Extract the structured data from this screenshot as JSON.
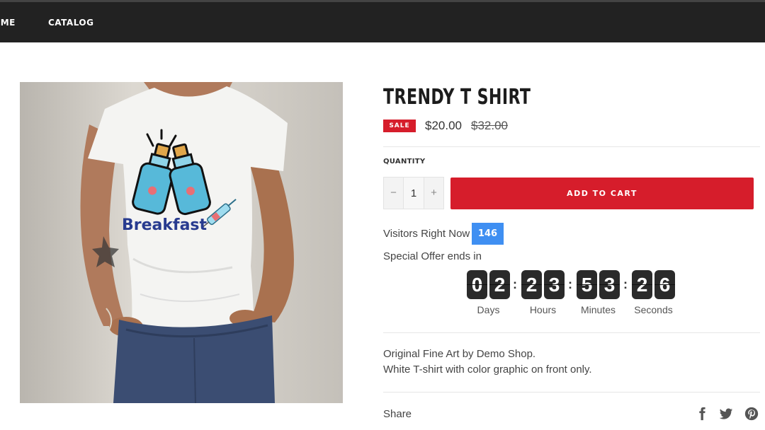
{
  "nav": {
    "items": [
      {
        "label": "OME"
      },
      {
        "label": "CATALOG"
      }
    ]
  },
  "product": {
    "title": "TRENDY T SHIRT",
    "sale_badge": "SALE",
    "price": "$20.00",
    "compare_price": "$32.00",
    "image_print_text": "Breakfast",
    "quantity_label": "QUANTITY",
    "quantity_value": "1",
    "minus_symbol": "−",
    "plus_symbol": "+",
    "add_to_cart_label": "ADD TO CART",
    "visitors_label": "Visitors Right Now",
    "visitors_count": "146",
    "offer_label": "Special Offer ends in",
    "countdown": {
      "units": [
        {
          "digits": [
            "0",
            "2"
          ],
          "label": "Days"
        },
        {
          "digits": [
            "2",
            "3"
          ],
          "label": "Hours"
        },
        {
          "digits": [
            "5",
            "3"
          ],
          "label": "Minutes"
        },
        {
          "digits": [
            "2",
            "6"
          ],
          "label": "Seconds"
        }
      ],
      "separator": ":"
    },
    "description": [
      "Original Fine Art by Demo Shop.",
      "White T-shirt with color graphic on front only."
    ],
    "share_label": "Share"
  },
  "social_icons": [
    "facebook-icon",
    "twitter-icon",
    "pinterest-icon"
  ],
  "colors": {
    "header_bg": "#222222",
    "sale_red": "#d61d2b",
    "visitors_blue": "#3f8ff2",
    "timer_digit_bg": "#2a2a2a"
  }
}
